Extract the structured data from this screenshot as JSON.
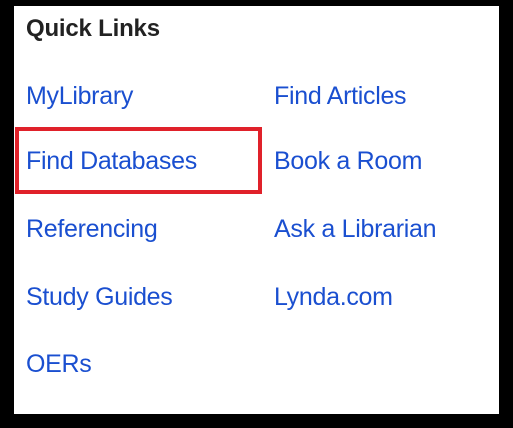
{
  "quick_links": {
    "title": "Quick Links",
    "left_column": [
      {
        "label": "MyLibrary"
      },
      {
        "label": "Find Databases"
      },
      {
        "label": "Referencing"
      },
      {
        "label": "Study Guides"
      },
      {
        "label": "OERs"
      }
    ],
    "right_column": [
      {
        "label": "Find Articles"
      },
      {
        "label": "Book a Room"
      },
      {
        "label": "Ask a Librarian"
      },
      {
        "label": "Lynda.com"
      }
    ],
    "highlighted_item": "Find Databases"
  },
  "colors": {
    "link": "#1a4fd0",
    "title": "#222222",
    "highlight_border": "#e0212a",
    "frame": "#000000"
  }
}
